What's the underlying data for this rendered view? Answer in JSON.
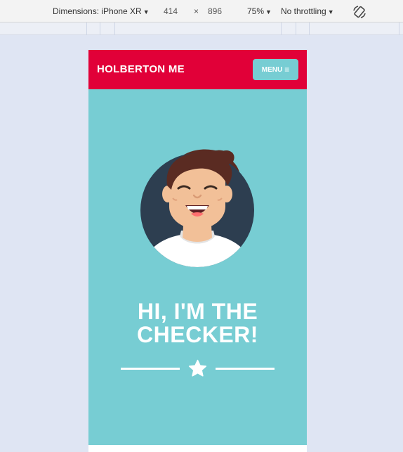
{
  "devtools": {
    "dimensions_label": "Dimensions: iPhone XR",
    "width": "414",
    "times": "×",
    "height": "896",
    "zoom": "75%",
    "throttling": "No throttling"
  },
  "site": {
    "brand": "HOLBERTON ME",
    "menu_label": "MENU",
    "menu_icon": "≡",
    "heading_line1": "HI, I'M THE",
    "heading_line2": "CHECKER!"
  },
  "colors": {
    "navbar": "#e10038",
    "hero": "#77cdd3",
    "avatar_bg": "#2d3e50"
  },
  "icons": {
    "rotate": "rotate-icon",
    "menu": "hamburger-icon",
    "star": "star-icon"
  }
}
